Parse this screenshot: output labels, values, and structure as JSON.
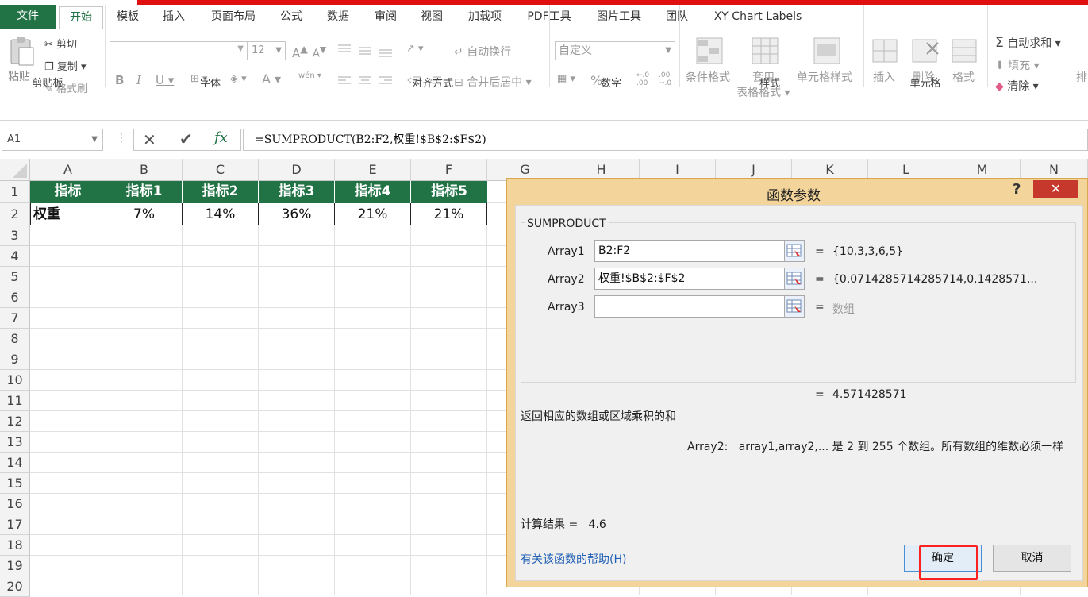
{
  "ribbon_tabs": [
    "文件",
    "开始",
    "模板",
    "插入",
    "页面布局",
    "公式",
    "数据",
    "审阅",
    "视图",
    "加载项",
    "PDF工具",
    "图片工具",
    "团队",
    "XY Chart Labels"
  ],
  "clipboard": {
    "paste": "粘贴",
    "cut": "剪切",
    "copy": "复制",
    "format_painter": "格式刷",
    "group": "剪贴板"
  },
  "font": {
    "size": "12",
    "group": "字体",
    "bold": "B",
    "italic": "I",
    "underline": "U",
    "grow": "A",
    "shrink": "A",
    "color": "A",
    "phonetic": "wén"
  },
  "alignment": {
    "wrap": "自动换行",
    "merge": "合并后居中",
    "group": "对齐方式"
  },
  "number": {
    "format": "自定义",
    "percent": "%",
    "comma": ",",
    "group": "数字"
  },
  "styles": {
    "conditional": "条件格式",
    "table": "套用",
    "table2": "表格格式",
    "cell_styles": "单元格样式",
    "group": "样式"
  },
  "cells": {
    "insert": "插入",
    "delete": "删除",
    "format": "格式",
    "group": "单元格"
  },
  "editing": {
    "autosum": "自动求和",
    "fill": "填充",
    "clear": "清除",
    "sort": "排"
  },
  "formula_bar": {
    "name_box": "A1",
    "fx": "fx",
    "formula": "=SUMPRODUCT(B2:F2,权重!$B$2:$F$2)"
  },
  "columns": [
    "A",
    "B",
    "C",
    "D",
    "E",
    "F",
    "G",
    "H",
    "I",
    "J",
    "K",
    "L",
    "M",
    "N"
  ],
  "rows": [
    "1",
    "2",
    "3",
    "4",
    "5",
    "6",
    "7",
    "8",
    "9",
    "10",
    "11",
    "12",
    "13",
    "14",
    "15",
    "16",
    "17",
    "18",
    "19",
    "20"
  ],
  "table": {
    "headers": [
      "指标",
      "指标1",
      "指标2",
      "指标3",
      "指标4",
      "指标5"
    ],
    "row2": [
      "权重",
      "7%",
      "14%",
      "36%",
      "21%",
      "21%"
    ]
  },
  "dialog": {
    "title": "函数参数",
    "help": "?",
    "close": "✕",
    "function_name": "SUMPRODUCT",
    "args": [
      {
        "label": "Array1",
        "value": "B2:F2",
        "result": "{10,3,3,6,5}"
      },
      {
        "label": "Array2",
        "value": "权重!$B$2:$F$2",
        "result": "{0.0714285714285714,0.1428571..."
      },
      {
        "label": "Array3",
        "value": "",
        "result": "数组"
      }
    ],
    "eq": "=",
    "formula_result": "4.571428571",
    "description": "返回相应的数组或区域乘积的和",
    "arg_help_label": "Array2:",
    "arg_help_text": "array1,array2,... 是 2 到 255 个数组。所有数组的维数必须一样",
    "calc_label": "计算结果 =",
    "calc_value": "4.6",
    "help_link": "有关该函数的帮助(H)",
    "ok": "确定",
    "cancel": "取消"
  },
  "colors": {
    "excel_green": "#217346",
    "dialog_border": "#f3d49a",
    "highlight": "#ff2020",
    "close_red": "#c7382c"
  }
}
